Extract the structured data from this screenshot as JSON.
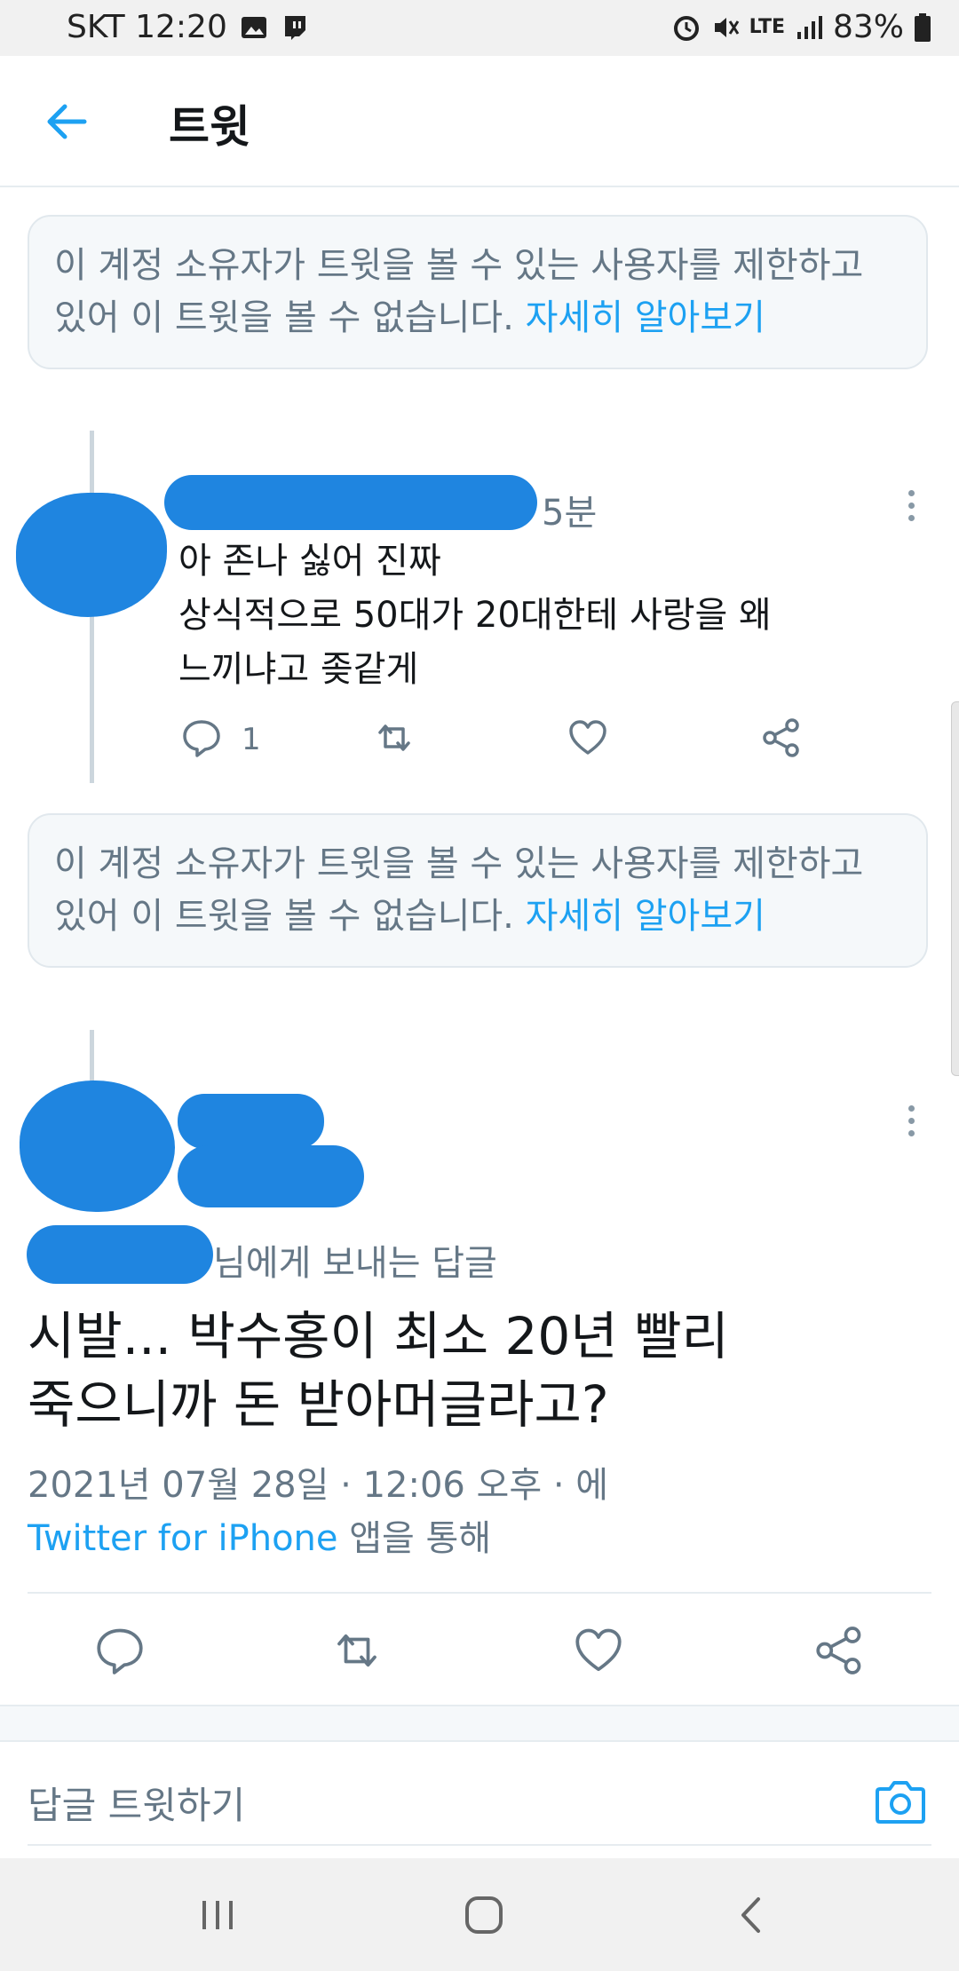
{
  "status_bar": {
    "carrier_time": "SKT 12:20",
    "battery": "83%",
    "network": "LTE"
  },
  "header": {
    "title": "트윗"
  },
  "notices": [
    {
      "text": "이 계정 소유자가 트윗을 볼 수 있는 사용자를 제한하고 있어 이 트윗을 볼 수 없습니다. ",
      "link": "자세히 알아보기"
    },
    {
      "text": "이 계정 소유자가 트윗을 볼 수 있는 사용자를 제한하고 있어 이 트윗을 볼 수 없습니다. ",
      "link": "자세히 알아보기"
    }
  ],
  "reply_tweet": {
    "time": "5분",
    "lines": [
      "아 존나 싫어 진짜",
      "상식적으로 50대가 20대한테 사랑을 왜",
      "느끼냐고 좆같게"
    ],
    "reply_count": "1"
  },
  "main_tweet": {
    "reply_to_suffix": "님에게 보내는 답글",
    "lines": [
      "시발... 박수홍이 최소 20년 빨리",
      "죽으니까 돈 받아머글라고?"
    ],
    "timestamp": "2021년 07월 28일 · 12:06 오후 · 에",
    "source_link": "Twitter for iPhone",
    "source_suffix": " 앱을 통해"
  },
  "reply_bar": {
    "placeholder": "답글 트윗하기"
  },
  "colors": {
    "accent": "#1da1f2",
    "secondary_text": "#657786",
    "redaction": "#1f85e0"
  }
}
